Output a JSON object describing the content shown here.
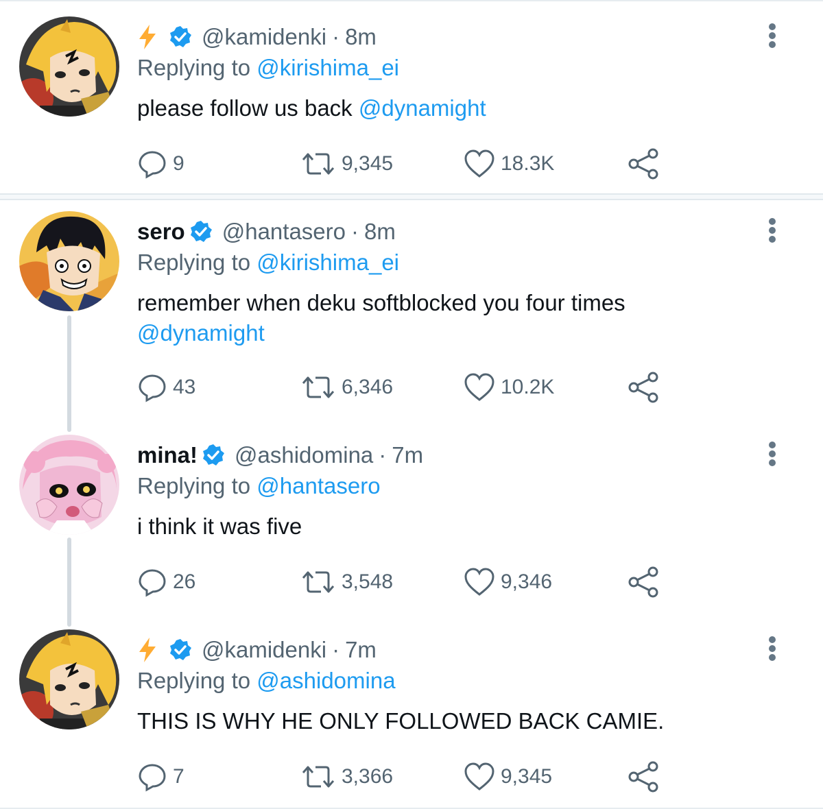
{
  "tweets": [
    {
      "display_name": "",
      "has_bolt": true,
      "handle": "@kamidenki",
      "dot": "·",
      "time": "8m",
      "replying_prefix": "Replying to",
      "replying_to": "@kirishima_ei",
      "text": "please follow us back",
      "text_mention": "@dynamight",
      "replies": "9",
      "retweets": "9,345",
      "likes": "18.3K",
      "avatar": "denki-avatar"
    },
    {
      "display_name": "sero",
      "has_bolt": false,
      "handle": "@hantasero",
      "dot": "·",
      "time": "8m",
      "replying_prefix": "Replying to",
      "replying_to": "@kirishima_ei",
      "text": "remember when deku softblocked you four times",
      "text_mention": "@dynamight",
      "replies": "43",
      "retweets": "6,346",
      "likes": "10.2K",
      "avatar": "sero-avatar"
    },
    {
      "display_name": "mina!",
      "has_bolt": false,
      "handle": "@ashidomina",
      "dot": "·",
      "time": "7m",
      "replying_prefix": "Replying to",
      "replying_to": "@hantasero",
      "text": "i think it was five",
      "text_mention": "",
      "replies": "26",
      "retweets": "3,548",
      "likes": "9,346",
      "avatar": "mina-avatar"
    },
    {
      "display_name": "",
      "has_bolt": true,
      "handle": "@kamidenki",
      "dot": "·",
      "time": "7m",
      "replying_prefix": "Replying to",
      "replying_to": "@ashidomina",
      "text": "THIS IS WHY HE ONLY FOLLOWED BACK CAMIE.",
      "text_mention": "",
      "replies": "7",
      "retweets": "3,366",
      "likes": "9,345",
      "avatar": "denki-avatar"
    }
  ],
  "colors": {
    "link": "#1d9bf0",
    "secondary_text": "#536471",
    "verified": "#1d9bf0",
    "bolt": "#ffac33"
  },
  "icons": [
    "bolt-icon",
    "verified-icon",
    "reply-icon",
    "retweet-icon",
    "like-icon",
    "share-icon",
    "more-icon"
  ]
}
